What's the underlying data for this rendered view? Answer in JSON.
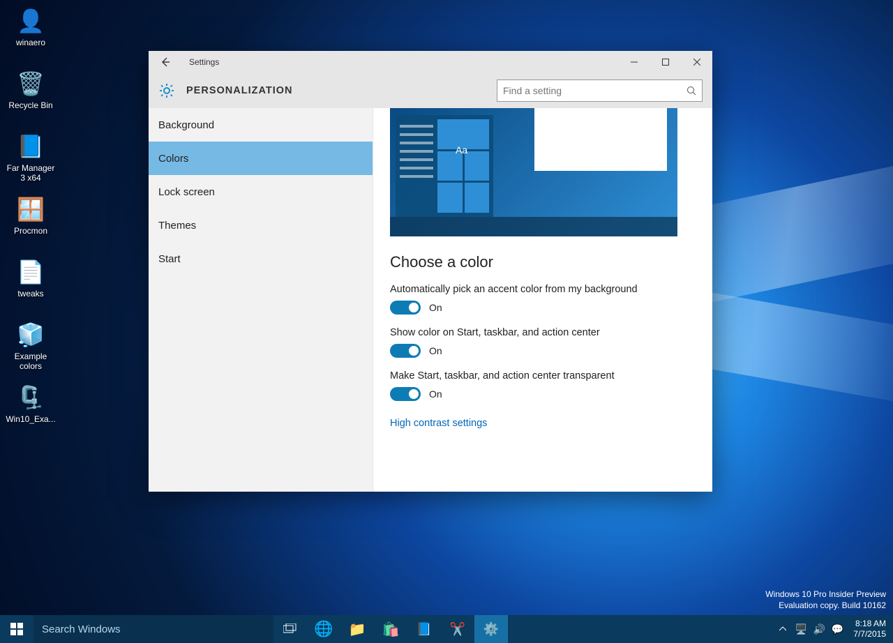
{
  "desktop_icons": [
    {
      "name": "winaero-icon",
      "label": "winaero",
      "glyph": "👤"
    },
    {
      "name": "recycle-bin-icon",
      "label": "Recycle Bin",
      "glyph": "🗑️"
    },
    {
      "name": "far-manager-icon",
      "label": "Far Manager 3 x64",
      "glyph": "📘"
    },
    {
      "name": "procmon-icon",
      "label": "Procmon",
      "glyph": "🪟"
    },
    {
      "name": "tweaks-icon",
      "label": "tweaks",
      "glyph": "📄"
    },
    {
      "name": "example-colors-icon",
      "label": "Example colors",
      "glyph": "🧊"
    },
    {
      "name": "win10-examples-icon",
      "label": "Win10_Exa...",
      "glyph": "🗜️"
    }
  ],
  "watermark": {
    "line1": "Windows 10 Pro Insider Preview",
    "line2": "Evaluation copy. Build 10162"
  },
  "settings": {
    "title": "Settings",
    "header": "PERSONALIZATION",
    "search_placeholder": "Find a setting",
    "sidebar": [
      {
        "label": "Background",
        "selected": false
      },
      {
        "label": "Colors",
        "selected": true
      },
      {
        "label": "Lock screen",
        "selected": false
      },
      {
        "label": "Themes",
        "selected": false
      },
      {
        "label": "Start",
        "selected": false
      }
    ],
    "preview_sample": "Aa",
    "main": {
      "section_title": "Choose a color",
      "options": [
        {
          "label": "Automatically pick an accent color from my background",
          "state": "On"
        },
        {
          "label": "Show color on Start, taskbar, and action center",
          "state": "On"
        },
        {
          "label": "Make Start, taskbar, and action center transparent",
          "state": "On"
        }
      ],
      "link": "High contrast settings"
    }
  },
  "taskbar": {
    "search_placeholder": "Search Windows",
    "clock": {
      "time": "8:18 AM",
      "date": "7/7/2015"
    }
  }
}
